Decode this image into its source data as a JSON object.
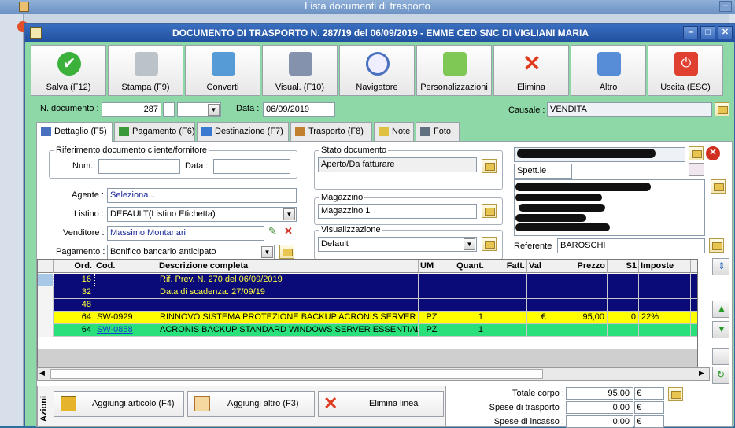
{
  "background": {
    "title": "Lista documenti di trasporto"
  },
  "window": {
    "title": "DOCUMENTO DI TRASPORTO N. 287/19 del 06/09/2019 - EMME CED SNC DI VIGLIANI MARIA"
  },
  "toolbar": [
    {
      "label": "Salva (F12)",
      "icon": "check-icon"
    },
    {
      "label": "Stampa (F9)",
      "icon": "printer-icon"
    },
    {
      "label": "Converti",
      "icon": "convert-icon"
    },
    {
      "label": "Visual. (F10)",
      "icon": "magic-wand-icon"
    },
    {
      "label": "Navigatore",
      "icon": "compass-icon"
    },
    {
      "label": "Personalizzazioni",
      "icon": "puzzle-icon"
    },
    {
      "label": "Elimina",
      "icon": "x-icon"
    },
    {
      "label": "Altro",
      "icon": "magnifier-icon"
    },
    {
      "label": "Uscita (ESC)",
      "icon": "exit-icon"
    }
  ],
  "header": {
    "ndoc_label": "N. documento :",
    "ndoc_value": "287",
    "data_label": "Data :",
    "data_value": "06/09/2019",
    "causale_label": "Causale :",
    "causale_value": "VENDITA"
  },
  "tabs": [
    {
      "label": "Dettaglio (F5)",
      "icon": "table-icon"
    },
    {
      "label": "Pagamento (F6)",
      "icon": "payment-icon"
    },
    {
      "label": "Destinazione (F7)",
      "icon": "globe-icon"
    },
    {
      "label": "Trasporto (F8)",
      "icon": "truck-icon"
    },
    {
      "label": "Note",
      "icon": "note-icon"
    },
    {
      "label": "Foto",
      "icon": "camera-icon"
    }
  ],
  "riferimento": {
    "title": "Riferimento documento cliente/fornitore",
    "num_label": "Num.:",
    "num_value": "",
    "data_label": "Data :",
    "data_value": ""
  },
  "fields": {
    "agente_label": "Agente :",
    "agente_value": "Seleziona...",
    "listino_label": "Listino :",
    "listino_value": "DEFAULT(Listino Etichetta)",
    "venditore_label": "Venditore :",
    "venditore_value": "Massimo Montanari",
    "pagamento_label": "Pagamento :",
    "pagamento_value": "Bonifico bancario anticipato"
  },
  "stato": {
    "title": "Stato documento",
    "value": "Aperto/Da fatturare"
  },
  "magazzino": {
    "title": "Magazzino",
    "value": "Magazzino 1"
  },
  "visualizzazione": {
    "title": "Visualizzazione",
    "value": "Default"
  },
  "cliente": {
    "spett": "Spett.le",
    "referente_label": "Referente",
    "referente_value": "BAROSCHI"
  },
  "grid": {
    "columns": [
      "Ord.",
      "Cod.",
      "Descrizione completa",
      "UM",
      "Quant.",
      "Fatt.",
      "Val",
      "Prezzo",
      "S1",
      "Imposte"
    ],
    "rows": [
      {
        "ord": "16",
        "cod": "",
        "desc": "Rif. Prev. N. 270 del 06/09/2019",
        "um": "",
        "quant": "",
        "fatt": "",
        "val": "",
        "prezzo": "",
        "s1": "",
        "imposte": ""
      },
      {
        "ord": "32",
        "cod": "",
        "desc": "Data di scadenza: 27/09/19",
        "um": "",
        "quant": "",
        "fatt": "",
        "val": "",
        "prezzo": "",
        "s1": "",
        "imposte": ""
      },
      {
        "ord": "48",
        "cod": "",
        "desc": "",
        "um": "",
        "quant": "",
        "fatt": "",
        "val": "",
        "prezzo": "",
        "s1": "",
        "imposte": ""
      },
      {
        "ord": "64",
        "cod": "SW-0929",
        "desc": "RINNOVO SISTEMA PROTEZIONE BACKUP ACRONIS SERVER EM...",
        "um": "PZ",
        "quant": "1",
        "fatt": "",
        "val": "€",
        "prezzo": "95,00",
        "s1": "0",
        "imposte": "22%"
      },
      {
        "ord": "64",
        "cod": "SW-0858",
        "desc": "ACRONIS BACKUP STANDARD WINDOWS SERVER ESSENTIALS LI...",
        "um": "PZ",
        "quant": "1",
        "fatt": "",
        "val": "",
        "prezzo": "",
        "s1": "",
        "imposte": ""
      }
    ]
  },
  "actions": {
    "title": "Azioni",
    "aggiungi_articolo": "Aggiungi articolo (F4)",
    "aggiungi_altro": "Aggiungi altro (F3)",
    "elimina_linea": "Elimina linea"
  },
  "totals": [
    {
      "label": "Totale corpo :",
      "value": "95,00",
      "currency": "€"
    },
    {
      "label": "Spese di trasporto :",
      "value": "0,00",
      "currency": "€"
    },
    {
      "label": "Spese di incasso :",
      "value": "0,00",
      "currency": "€"
    }
  ]
}
